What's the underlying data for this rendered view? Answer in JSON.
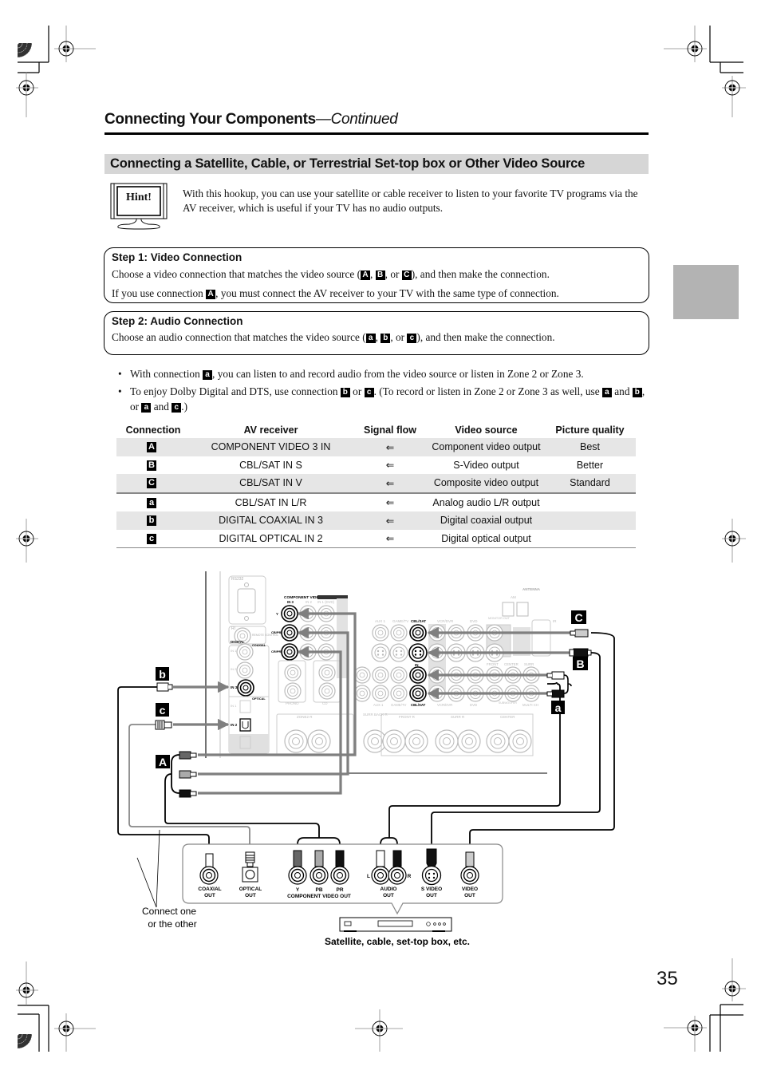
{
  "header": {
    "title": "Connecting Your Components",
    "continued": "—Continued"
  },
  "section": {
    "title": "Connecting a Satellite, Cable, or Terrestrial Set-top box or Other Video Source"
  },
  "hint": {
    "icon_label": "Hint!",
    "text": "With this hookup, you can use your satellite or cable receiver to listen to your favorite TV programs via the AV receiver, which is useful if your TV has no audio outputs."
  },
  "step1": {
    "title": "Step 1: Video Connection",
    "line1_pre": "Choose a video connection that matches the video source (",
    "line1_post": "), and then make the connection.",
    "line2_pre": "If you use connection ",
    "line2_post": ", you must connect the AV receiver to your TV with the same type of connection.",
    "sep_comma": ", ",
    "sep_or": ", or "
  },
  "step2": {
    "title": "Step 2: Audio Connection",
    "line1_pre": "Choose an audio connection that matches the video source (",
    "line1_post": "), and then make the connection.",
    "sep_comma": ", ",
    "sep_or": ", or "
  },
  "labels": {
    "A": "A",
    "B": "B",
    "C": "C",
    "a": "a",
    "b": "b",
    "c": "c"
  },
  "bullets": {
    "b1_pre": "With connection ",
    "b1_post": ", you can listen to and record audio from the video source or listen in Zone 2 or Zone 3.",
    "b2_pre": "To enjoy Dolby Digital and DTS, use connection ",
    "b2_or": " or ",
    "b2_mid": ". (To record or listen in Zone 2 or Zone 3 as well, use ",
    "b2_and1": " and ",
    "b2_comma_or": ", or ",
    "b2_and2": " and ",
    "b2_end": ".)"
  },
  "table": {
    "headers": [
      "Connection",
      "AV receiver",
      "Signal flow",
      "Video source",
      "Picture quality"
    ],
    "rows": [
      {
        "connection": "A",
        "receiver": "COMPONENT VIDEO 3 IN",
        "flow": "⇐",
        "source": "Component video output",
        "quality": "Best"
      },
      {
        "connection": "B",
        "receiver": "CBL/SAT IN S",
        "flow": "⇐",
        "source": "S-Video output",
        "quality": "Better"
      },
      {
        "connection": "C",
        "receiver": "CBL/SAT IN V",
        "flow": "⇐",
        "source": "Composite video output",
        "quality": "Standard"
      },
      {
        "connection": "a",
        "receiver": "CBL/SAT IN L/R",
        "flow": "⇐",
        "source": "Analog audio L/R output",
        "quality": ""
      },
      {
        "connection": "b",
        "receiver": "DIGITAL COAXIAL IN 3",
        "flow": "⇐",
        "source": "Digital coaxial output",
        "quality": ""
      },
      {
        "connection": "c",
        "receiver": "DIGITAL OPTICAL IN 2",
        "flow": "⇐",
        "source": "Digital optical output",
        "quality": ""
      }
    ]
  },
  "diagram": {
    "receiver_labels": {
      "rs232": "RS232",
      "ri": "RI",
      "remote_control": "REMOTE CONTROL",
      "digital": "DIGITAL",
      "coaxial": "COAXIAL",
      "optical": "OPTICAL",
      "in1": "IN 1",
      "in2": "IN 2",
      "in3": "IN 3",
      "component_video": "COMPONENT VIDEO",
      "comp_in3": "IN 3",
      "comp_in2": "IN 2",
      "comp_in1": "IN 1 (DVD)",
      "monitor_out": "MONITOR OUT",
      "y": "Y",
      "cb": "CB/PB",
      "cr": "CR/PR",
      "phono": "PHONO",
      "cd": "CD",
      "aux1": "AUX 1",
      "gametv": "GAME/TV",
      "cblsat": "CBL/SAT",
      "vcrdvr": "VCR/DVR",
      "dvd": "DVD",
      "antenna": "ANTENNA",
      "am": "AM",
      "ir": "IR",
      "front": "FRONT",
      "center": "CENTER",
      "surr": "SURR",
      "multich": "MULTI CH",
      "subwoofer": "SUBWOOFER",
      "zone2r": "ZONE2 R",
      "surrbackr": "SURR BACK R",
      "frontr": "FRONT R",
      "surrr": "SURR R",
      "centersp": "CENTER",
      "in_label": "IN",
      "l": "L",
      "r": "R",
      "plus": "+",
      "minus": "−"
    },
    "source_outputs": [
      {
        "label": "COAXIAL\nOUT",
        "l1": "COAXIAL",
        "l2": "OUT"
      },
      {
        "label": "OPTICAL\nOUT",
        "l1": "OPTICAL",
        "l2": "OUT"
      },
      {
        "l1": "Y",
        "l2": ""
      },
      {
        "l1": "PB",
        "l2": ""
      },
      {
        "l1": "PR",
        "l2": ""
      },
      {
        "l1": "AUDIO",
        "l2": "OUT"
      },
      {
        "l1": "S VIDEO",
        "l2": "OUT"
      },
      {
        "l1": "VIDEO",
        "l2": "OUT"
      }
    ],
    "component_video_out": "COMPONENT VIDEO OUT",
    "audio_l": "L",
    "audio_r": "R",
    "connect_note": "Connect one or the other",
    "connect_note_l1": "Connect one",
    "connect_note_l2": "or the other",
    "device_caption": "Satellite, cable, set-top box, etc."
  },
  "page_number": "35"
}
